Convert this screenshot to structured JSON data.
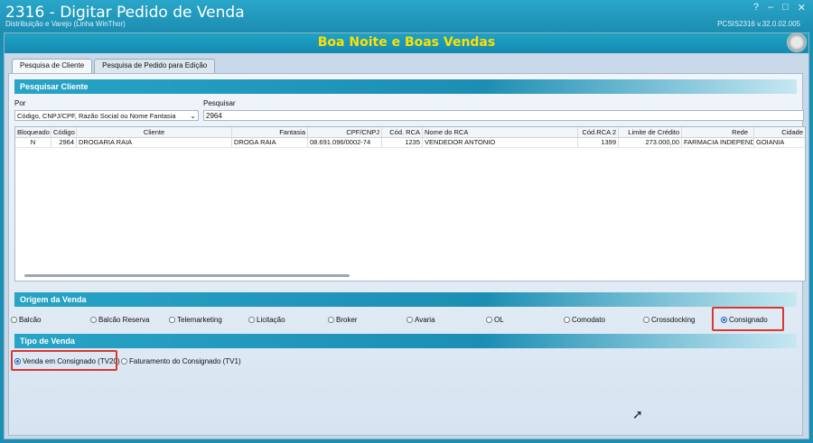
{
  "window": {
    "title": "2316 - Digitar Pedido de Venda",
    "subtitle": "Distribuição e Varejo (Linha WinThor)",
    "version": "PCSIS2316  v.32.0.02.005",
    "buttons": [
      "?",
      "–",
      "□",
      "✕"
    ]
  },
  "banner": {
    "greeting": "Boa Noite e Boas Vendas"
  },
  "tabs": [
    {
      "label": "Pesquisa de Cliente",
      "active": true
    },
    {
      "label": "Pesquisa de Pedido para Edição",
      "active": false
    }
  ],
  "pesquisar_cliente": {
    "section_title": "Pesquisar Cliente",
    "por_label": "Por",
    "por_value": "Código, CNPJ/CPF, Razão Social ou Nome Fantasia",
    "pesquisar_label": "Pesquisar",
    "pesquisar_value": "2964"
  },
  "grid": {
    "columns": [
      "Bloqueado",
      "Código",
      "Cliente",
      "Fantasia",
      "CPF/CNPJ",
      "Cód. RCA",
      "Nome do RCA",
      "Cód.RCA 2",
      "Limite de Crédito",
      "Rede",
      "Cidade"
    ],
    "rows": [
      [
        "N",
        "2964",
        "DROGARIA RAIA",
        "DROGA RAIA",
        "08.691.096/0002-74",
        "1235",
        "VENDEDOR ANTONIO",
        "1399",
        "273.000,00",
        "FARMACIA INDEPENDENTE",
        "GOIANIA"
      ]
    ]
  },
  "origem": {
    "section_title": "Origem da Venda",
    "options": [
      "Balcão",
      "Balcão Reserva",
      "Telemarketing",
      "Licitação",
      "Broker",
      "Avaria",
      "OL",
      "Comodato",
      "Crossdocking",
      "Consignado"
    ],
    "selected": "Consignado"
  },
  "tipo": {
    "section_title": "Tipo de Venda",
    "options": [
      "Venda em Consignado (TV20)",
      "Faturamento do Consignado (TV1)"
    ],
    "selected": "Venda em Consignado (TV20)"
  },
  "colors": {
    "title_bar": "#1c8db1",
    "greeting": "#ffe000",
    "highlight": "#d9382f",
    "section": "#1c8eb3"
  }
}
